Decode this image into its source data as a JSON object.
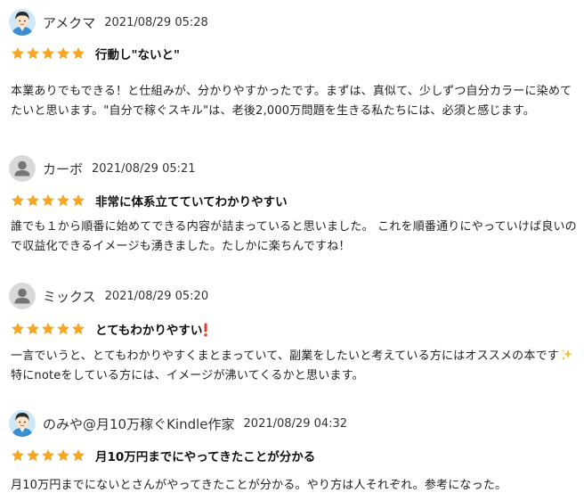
{
  "colors": {
    "star": "#f5a623",
    "text": "#222222",
    "avatar_bg_gray": "#d9d9d9",
    "avatar_icon_gray": "#757575"
  },
  "reviews": [
    {
      "user": "アメクマ",
      "avatar": "cartoon-man-avatar",
      "date": "2021/08/29 05:28",
      "rating": 5,
      "title": "行動し\"ないと\"",
      "body": "本業ありでもできる！と仕組みが、分かりやすかったです。まずは、真似て、少しずつ自分カラーに染めてたいと思います。\"自分で稼ぐスキル\"は、老後2,000万問題を生きる私たちには、必須と感じます。"
    },
    {
      "user": "カーボ",
      "avatar": "default-user-avatar",
      "date": "2021/08/29 05:21",
      "rating": 5,
      "title": "非常に体系立てていてわかりやすい",
      "body": "誰でも１から順番に始めてできる内容が詰まっていると思いました。 これを順番通りにやっていけば良いので収益化できるイメージも湧きました。たしかに楽ちんですね！"
    },
    {
      "user": "ミックス",
      "avatar": "default-user-avatar",
      "date": "2021/08/29 05:20",
      "rating": 5,
      "title": "とてもわかりやすい",
      "title_emoji": "exclamation-emoji",
      "body_part1": "一言でいうと、とてもわかりやすくまとまっていて、副業をしたいと考えている方にはオススメの本です",
      "body_emoji": "sparkles-emoji",
      "body_part2": "特にnoteをしている方には、イメージが沸いてくるかと思います。"
    },
    {
      "user": "のみや@月10万稼ぐKindle作家",
      "avatar": "cartoon-man-avatar",
      "date": "2021/08/29 04:32",
      "rating": 5,
      "title": "月10万円までにやってきたことが分かる",
      "body": "月10万円までにないとさんがやってきたことが分かる。やり方は人それぞれ。参考になった。"
    }
  ]
}
